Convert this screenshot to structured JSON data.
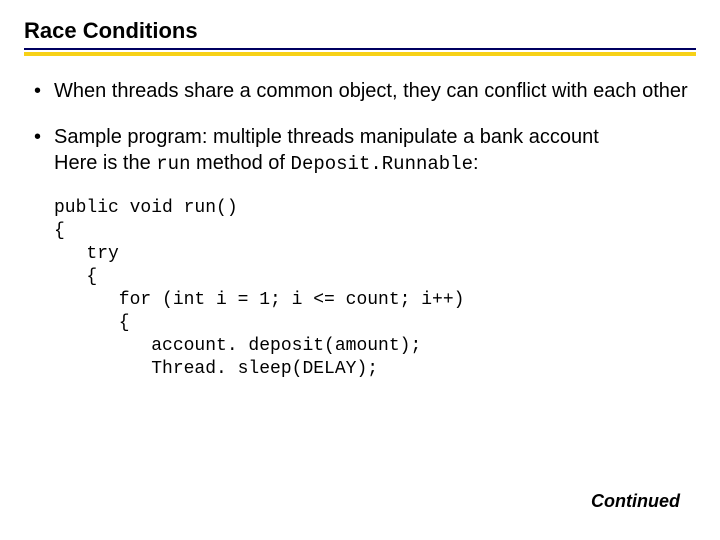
{
  "title": "Race Conditions",
  "bullets": {
    "b1": "When threads share a common object, they can conflict with each other",
    "b2_line1": "Sample program: multiple threads manipulate a bank account",
    "b2_prefix": "Here is the ",
    "b2_code1": "run",
    "b2_mid": " method of ",
    "b2_code2": "Deposit.Runnable",
    "b2_suffix": ":"
  },
  "code": "public void run()\n{\n   try\n   {\n      for (int i = 1; i <= count; i++)\n      {\n         account. deposit(amount);\n         Thread. sleep(DELAY);",
  "footer": "Continued"
}
